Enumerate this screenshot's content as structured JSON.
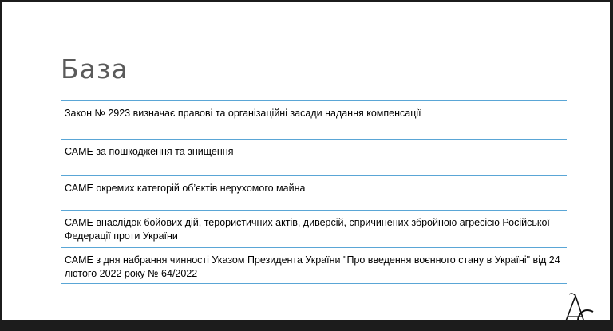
{
  "slide": {
    "title": "База",
    "items": [
      "Закон № 2923 визначає правові та організаційні засади надання компенсації",
      "САМЕ за пошкодження та знищення",
      "САМЕ  окремих категорій об’єктів нерухомого майна",
      "САМЕ внаслідок бойових дій, терористичних актів, диверсій, спричинених збройною агресією Російської Федерації проти України",
      "САМЕ з дня набрання чинності Указом Президента України \"Про введення воєнного стану в Україні\" від 24 лютого 2022 року № 64/2022"
    ],
    "logo_letters": "АС"
  },
  "colors": {
    "title": "#5a5a5a",
    "rule": "#5aa6d6",
    "background": "#ffffff",
    "frame": "#1c1c1c"
  }
}
